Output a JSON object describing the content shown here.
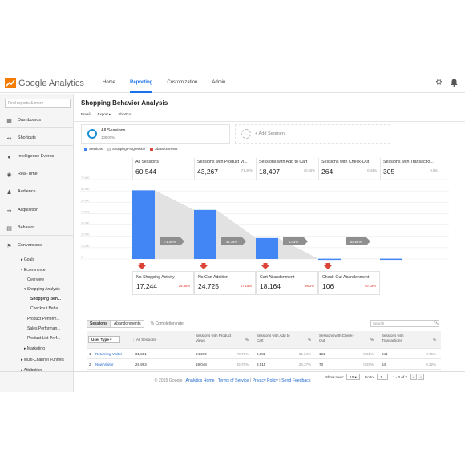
{
  "app": {
    "name": "Google Analytics"
  },
  "nav": {
    "items": [
      "Home",
      "Reporting",
      "Customization",
      "Admin"
    ],
    "active_index": 1
  },
  "sidebar": {
    "search_placeholder": "Find reports & more",
    "items": [
      {
        "label": "Dashboards",
        "icon": "grid-icon"
      },
      {
        "label": "Shortcuts",
        "icon": "shortcut-icon"
      },
      {
        "label": "Intelligence Events",
        "icon": "lightbulb-icon"
      },
      {
        "label": "Real-Time",
        "icon": "clock-icon"
      },
      {
        "label": "Audience",
        "icon": "people-icon"
      },
      {
        "label": "Acquisition",
        "icon": "acquisition-icon"
      },
      {
        "label": "Behavior",
        "icon": "behavior-icon"
      },
      {
        "label": "Conversions",
        "icon": "flag-icon"
      }
    ],
    "sub_items": [
      "▸ Goals",
      "▾ Ecommerce",
      "Overview",
      "▾ Shopping Analysis",
      "Shopping Beh...",
      "Checkout Beha...",
      "Product Perform...",
      "Sales Performan...",
      "Product List Perf...",
      "▸ Marketing",
      "▸ Multi-Channel Funnels",
      "▸ Attribution"
    ]
  },
  "page": {
    "title": "Shopping Behavior Analysis",
    "toolbar": [
      "Email",
      "Export ▸",
      "Shortcut"
    ]
  },
  "segments": {
    "primary": {
      "name": "All Sessions",
      "pct": "100.00%"
    },
    "add_label": "+ Add Segment"
  },
  "legend": [
    {
      "label": "Sessions",
      "color": "#4285f4"
    },
    {
      "label": "Shopping Progression",
      "color": "#dcdcdc"
    },
    {
      "label": "Abandonments",
      "color": "#db4437"
    }
  ],
  "funnel": {
    "stages": [
      {
        "title": "All Sessions",
        "value": "60,544",
        "pct": ""
      },
      {
        "title": "Sessions with Product Vi...",
        "value": "43,267",
        "pct": "71.46%"
      },
      {
        "title": "Sessions with Add to Cart",
        "value": "18,497",
        "pct": "30.55%"
      },
      {
        "title": "Sessions with Check-Out",
        "value": "264",
        "pct": "0.44%"
      },
      {
        "title": "Sessions with Transactio...",
        "value": "305",
        "pct": "0.5%"
      }
    ],
    "progression_labels": [
      "71.46%",
      "42.75%",
      "1.43%",
      "55.65%"
    ],
    "abandonments": [
      {
        "title": "No Shopping Activity",
        "value": "17,244",
        "pct": "28.48%"
      },
      {
        "title": "No Cart Addition",
        "value": "24,725",
        "pct": "57.15%"
      },
      {
        "title": "Cart Abandonment",
        "value": "18,164",
        "pct": "98.2%"
      },
      {
        "title": "Check-Out Abandonment",
        "value": "106",
        "pct": "40.15%"
      }
    ],
    "y_tick_labels": [
      "70,000",
      "60,000",
      "50,000",
      "40,000",
      "30,000",
      "20,000",
      "10,000",
      "0"
    ]
  },
  "chart_data": {
    "type": "bar",
    "categories": [
      "All Sessions",
      "Sessions with Product Vi...",
      "Sessions with Add to Cart",
      "Sessions with Check-Out",
      "Sessions with Transactio..."
    ],
    "values": [
      60544,
      43267,
      18497,
      264,
      305
    ],
    "ylim": [
      0,
      70000
    ]
  },
  "table": {
    "tabs": [
      "Sessions",
      "Abandonments"
    ],
    "active_tab": 0,
    "tab_note": "% Completion rate",
    "search_placeholder": "Search",
    "dimension_label": "User Type",
    "columns": [
      "All Sessions",
      "Sessions with Product Views",
      "%",
      "Sessions with Add to Cart",
      "%",
      "Sessions with Check-Out",
      "%",
      "Sessions with Transactions",
      "%"
    ],
    "rows": [
      [
        "1",
        "Returning Visitor",
        "31,551",
        "24,219",
        "76.76%",
        "9,982",
        "31.64%",
        "191",
        "0.61%",
        "241",
        "0.76%"
      ],
      [
        "2",
        "New Visitor",
        "28,993",
        "19,048",
        "65.70%",
        "8,515",
        "29.37%",
        "73",
        "0.25%",
        "64",
        "0.22%"
      ]
    ],
    "pager": {
      "show_rows_label": "Show rows:",
      "rows_value": "10",
      "goto_label": "Go to:",
      "goto_value": "1",
      "range": "1 - 2 of 2"
    }
  },
  "footer": {
    "copyright": "© 2015 Google",
    "links": [
      "Analytics Home",
      "Terms of Service",
      "Privacy Policy",
      "Send Feedback"
    ]
  }
}
